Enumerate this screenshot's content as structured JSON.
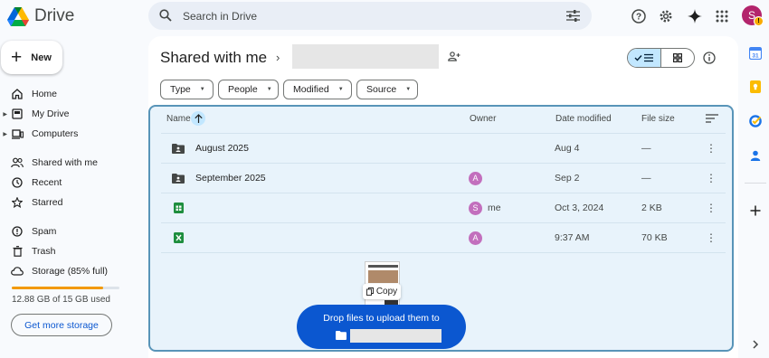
{
  "app": {
    "name": "Drive"
  },
  "search": {
    "placeholder": "Search in Drive"
  },
  "user": {
    "avatar_letter": "S",
    "badge": "!"
  },
  "sidebar": {
    "new_label": "New",
    "items": [
      {
        "label": "Home",
        "icon": "home-icon"
      },
      {
        "label": "My Drive",
        "icon": "my-drive-icon"
      },
      {
        "label": "Computers",
        "icon": "computers-icon"
      },
      {
        "label": "Shared with me",
        "icon": "shared-icon"
      },
      {
        "label": "Recent",
        "icon": "clock-icon"
      },
      {
        "label": "Starred",
        "icon": "star-icon"
      },
      {
        "label": "Spam",
        "icon": "spam-icon"
      },
      {
        "label": "Trash",
        "icon": "trash-icon"
      },
      {
        "label": "Storage (85% full)",
        "icon": "cloud-icon"
      }
    ],
    "storage_used_fraction": 0.85,
    "storage_text": "12.88 GB of 15 GB used",
    "get_storage_label": "Get more storage"
  },
  "main": {
    "title": "Shared with me",
    "filters": [
      "Type",
      "People",
      "Modified",
      "Source"
    ],
    "columns": {
      "name": "Name",
      "owner": "Owner",
      "modified": "Date modified",
      "size": "File size"
    },
    "rows": [
      {
        "name": "August 2025",
        "owner": "",
        "modified": "Aug 4",
        "size": "—",
        "icon": "shared-folder-icon",
        "avatar": ""
      },
      {
        "name": "September 2025",
        "owner": "",
        "modified": "Sep 2",
        "size": "—",
        "icon": "shared-folder-icon",
        "avatar": "A"
      },
      {
        "name": "",
        "owner": "me",
        "modified": "Oct 3, 2024",
        "size": "2 KB",
        "icon": "sheets-icon",
        "avatar": "S"
      },
      {
        "name": "",
        "owner": "",
        "modified": "9:37 AM",
        "size": "70 KB",
        "icon": "excel-icon",
        "avatar": "A"
      }
    ]
  },
  "drag": {
    "copy_label": "Copy",
    "upload_text": "Drop files to upload them to"
  },
  "colors": {
    "accent": "#0b57d0",
    "drop_bg": "#e8f3fb",
    "storage_fill": "#f29900",
    "toggle_on": "#c2e7ff"
  }
}
